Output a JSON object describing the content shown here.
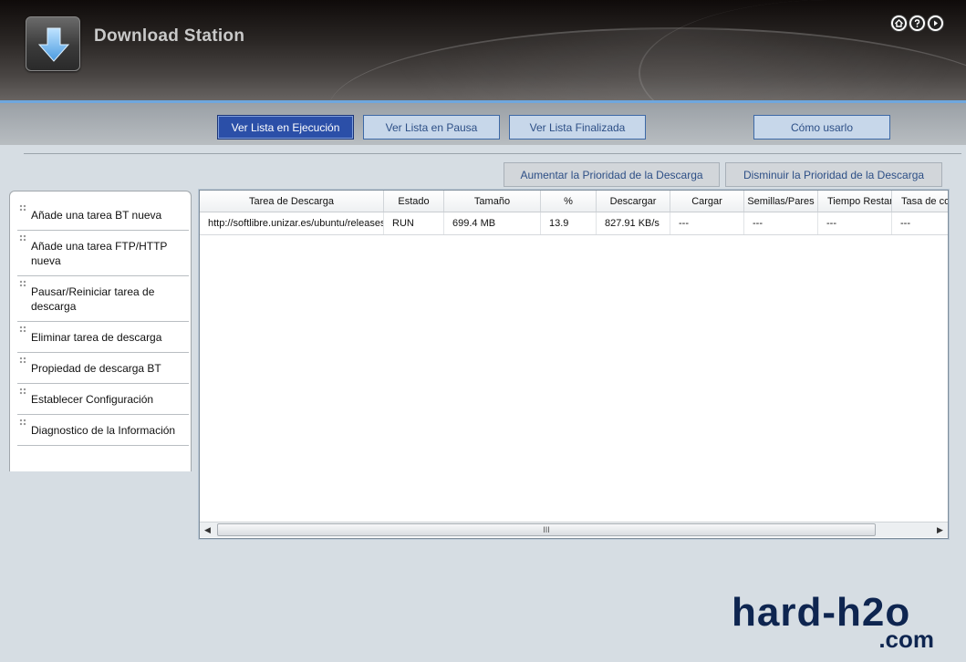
{
  "app": {
    "title": "Download Station",
    "icon": "download-arrow-icon"
  },
  "header_icons": [
    "home-icon",
    "help-icon",
    "next-icon"
  ],
  "tabs": [
    {
      "label": "Ver Lista en Ejecución",
      "active": true
    },
    {
      "label": "Ver Lista en Pausa",
      "active": false
    },
    {
      "label": "Ver Lista Finalizada",
      "active": false
    },
    {
      "label": "Cómo usarlo",
      "active": false
    }
  ],
  "priority": {
    "increase_label": "Aumentar la Prioridad de la Descarga",
    "decrease_label": "Disminuir la Prioridad de la Descarga"
  },
  "menu": [
    "Añade una tarea BT nueva",
    "Añade una tarea FTP/HTTP nueva",
    "Pausar/Reiniciar tarea de descarga",
    "Eliminar tarea de descarga",
    "Propiedad de descarga BT",
    "Establecer Configuración",
    "Diagnostico de la Información"
  ],
  "table": {
    "columns": [
      "Tarea de Descarga",
      "Estado",
      "Tamaño",
      "%",
      "Descargar",
      "Cargar",
      "Semillas/Pares",
      "Tiempo Restante",
      "Tasa de compartición"
    ],
    "rows": [
      [
        "http://softlibre.unizar.es/ubuntu/releases",
        "RUN",
        "699.4 MB",
        "13.9",
        "827.91 KB/s",
        "---",
        "---",
        "---",
        "---"
      ]
    ]
  },
  "scrollbar": {
    "thumb_label": "III"
  },
  "watermark": {
    "main": "hard-h2o",
    "sub": ".com"
  },
  "colors": {
    "active_tab": "#2b4fa8",
    "inactive_tab": "#c7d7ea",
    "link_text": "#2d4f86",
    "accent_line": "#6fa7de",
    "watermark": "#0e2550"
  }
}
